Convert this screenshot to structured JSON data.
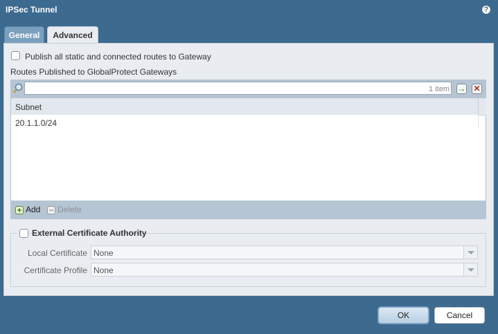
{
  "dialog": {
    "title": "IPSec Tunnel",
    "help_icon": "?"
  },
  "tabs": [
    {
      "label": "General",
      "active": false
    },
    {
      "label": "Advanced",
      "active": true
    }
  ],
  "publish_routes": {
    "label": "Publish all static and connected routes to Gateway",
    "checked": false
  },
  "routes_section_label": "Routes Published to GlobalProtect Gateways",
  "routes_grid": {
    "search_placeholder": "",
    "item_count": "1 item",
    "columns": [
      "Subnet"
    ],
    "rows": [
      {
        "subnet": "20.1.1.0/24"
      }
    ],
    "add_label": "Add",
    "delete_label": "Delete"
  },
  "external_ca": {
    "label": "External Certificate Authority",
    "checked": false,
    "local_certificate": {
      "label": "Local Certificate",
      "value": "None"
    },
    "certificate_profile": {
      "label": "Certificate Profile",
      "value": "None"
    }
  },
  "buttons": {
    "ok": "OK",
    "cancel": "Cancel"
  },
  "colors": {
    "frame": "#3d6a8f",
    "panel": "#e9edf1",
    "toolbar": "#b5c5d3"
  },
  "icons": {
    "help": "help-icon",
    "search": "search-icon",
    "apply_filter": "arrow-right-icon",
    "clear_filter": "close-icon",
    "add": "plus-icon",
    "delete": "minus-icon"
  }
}
